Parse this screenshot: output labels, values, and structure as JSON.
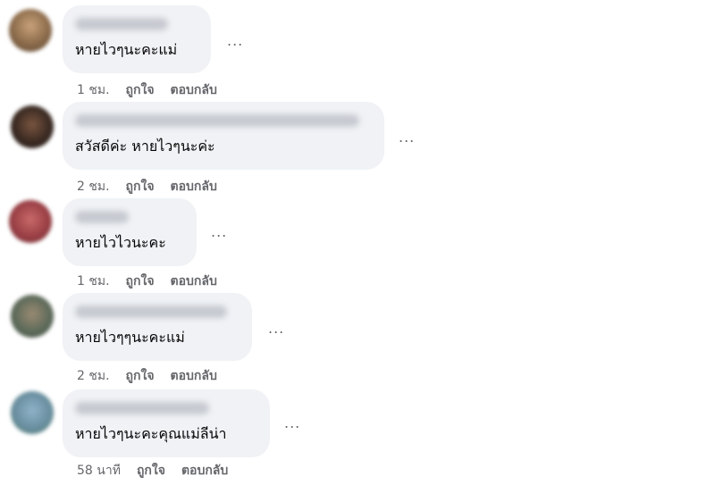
{
  "comments": [
    {
      "text": "หายไวๆนะคะแม่",
      "time": "1 ชม.",
      "like": "ถูกใจ",
      "reply": "ตอบกลับ",
      "more": "..."
    },
    {
      "text": "สวัสดีค่ะ หายไวๆนะค่ะ",
      "time": "2 ชม.",
      "like": "ถูกใจ",
      "reply": "ตอบกลับ",
      "more": "..."
    },
    {
      "text": "หายไวไวนะคะ",
      "time": "1 ชม.",
      "like": "ถูกใจ",
      "reply": "ตอบกลับ",
      "more": "..."
    },
    {
      "text": "หายไวๆๆนะคะแม่",
      "time": "2 ชม.",
      "like": "ถูกใจ",
      "reply": "ตอบกลับ",
      "more": "..."
    },
    {
      "text": "หายไวๆนะคะคุณแม่ลีน่า",
      "time": "58 นาที",
      "like": "ถูกใจ",
      "reply": "ตอบกลับ",
      "more": "..."
    }
  ],
  "colors": {
    "bubble": "#f0f2f5",
    "text": "#050505",
    "meta": "#65676b"
  }
}
